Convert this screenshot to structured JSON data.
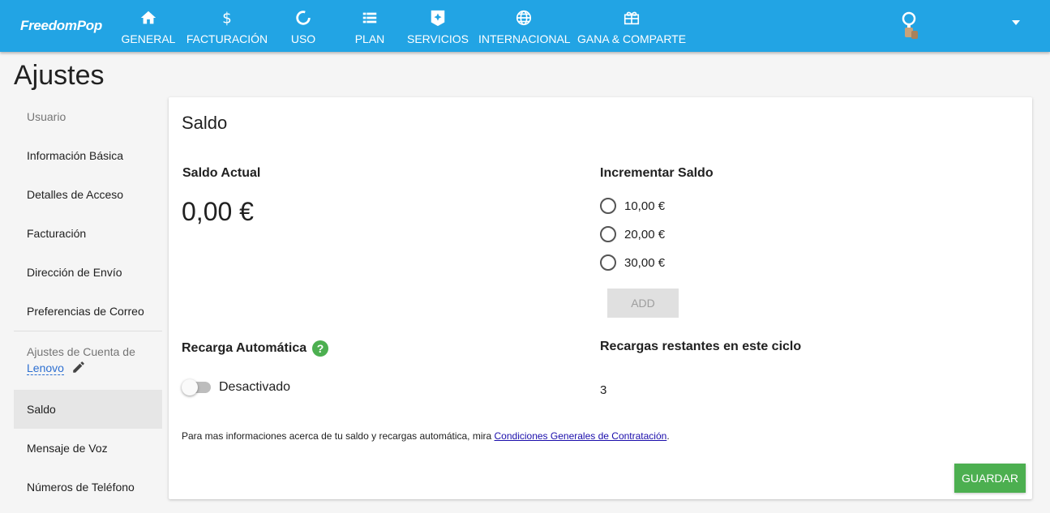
{
  "nav": {
    "logo": "FreedomPop",
    "items": [
      {
        "label": "GENERAL",
        "icon": "home-icon"
      },
      {
        "label": "FACTURACIÓN",
        "icon": "dollar-icon"
      },
      {
        "label": "USO",
        "icon": "usage-ring-icon"
      },
      {
        "label": "PLAN",
        "icon": "list-icon"
      },
      {
        "label": "SERVICIOS",
        "icon": "services-badge-icon"
      },
      {
        "label": "INTERNACIONAL",
        "icon": "globe-icon"
      },
      {
        "label": "GANA & COMPARTE",
        "icon": "gift-icon"
      }
    ]
  },
  "page": {
    "title": "Ajustes"
  },
  "sidebar": {
    "user_header": "Usuario",
    "user_items": [
      "Información Básica",
      "Detalles de Acceso",
      "Facturación",
      "Dirección de Envío",
      "Preferencias de Correo"
    ],
    "account_header": "Ajustes de Cuenta de",
    "account_name": "Lenovo",
    "account_items": [
      "Saldo",
      "Mensaje de Voz",
      "Números de Teléfono"
    ],
    "active": "Saldo"
  },
  "card": {
    "title": "Saldo",
    "current_balance_label": "Saldo Actual",
    "current_balance_value": "0,00 €",
    "increase_label": "Incrementar Saldo",
    "options": [
      "10,00 €",
      "20,00 €",
      "30,00 €"
    ],
    "add_label": "ADD",
    "auto_recharge_label": "Recarga Automática",
    "auto_recharge_help": "?",
    "auto_recharge_state": "Desactivado",
    "remaining_label": "Recargas restantes en este ciclo",
    "remaining_value": "3",
    "info_text": "Para mas informaciones acerca de tu saldo y recargas automática, mira ",
    "info_link": "Condiciones Generales de Contratación",
    "info_end": ".",
    "save_label": "GUARDAR"
  },
  "colors": {
    "header": "#22a4e4",
    "accent_green": "#4caf50",
    "link": "#1a0dab"
  }
}
